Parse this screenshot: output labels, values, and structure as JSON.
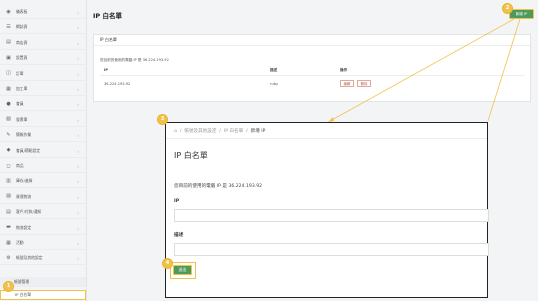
{
  "sidebar": {
    "items": [
      {
        "label": "儀表板",
        "icon": "dashboard-icon",
        "glyph": "◉"
      },
      {
        "label": "網誌頁",
        "icon": "blog-icon",
        "glyph": "☰"
      },
      {
        "label": "商店頁",
        "icon": "shop-icon",
        "glyph": "▤"
      },
      {
        "label": "設置頁",
        "icon": "settings-icon",
        "glyph": "▣"
      },
      {
        "label": "訂單",
        "icon": "order-icon",
        "glyph": "◫"
      },
      {
        "label": "加工單",
        "icon": "work-order-icon",
        "glyph": "▦"
      },
      {
        "label": "會員",
        "icon": "member-icon",
        "glyph": "●"
      },
      {
        "label": "發票單",
        "icon": "invoice-icon",
        "glyph": "▧"
      },
      {
        "label": "簡報作業",
        "icon": "report-icon",
        "glyph": "✎"
      },
      {
        "label": "會員/積點設定",
        "icon": "points-icon",
        "glyph": "◆"
      },
      {
        "label": "商品",
        "icon": "product-icon",
        "glyph": "◻"
      },
      {
        "label": "庫存/進貨",
        "icon": "inventory-icon",
        "glyph": "▥"
      },
      {
        "label": "貨運物流",
        "icon": "shipping-icon",
        "glyph": "▨"
      },
      {
        "label": "客戶/付款/通知",
        "icon": "customer-icon",
        "glyph": "▤"
      },
      {
        "label": "物流設定",
        "icon": "logistics-icon",
        "glyph": "▬"
      },
      {
        "label": "活動",
        "icon": "event-icon",
        "glyph": "▦"
      },
      {
        "label": "帳號及其他設定",
        "icon": "account-icon",
        "glyph": "⚙"
      }
    ],
    "sub_items": [
      {
        "label": "帳號管理"
      },
      {
        "label": "IP 白名單"
      }
    ]
  },
  "header": {
    "title": "IP 白名單",
    "add_button": "新增 IP"
  },
  "panel": {
    "title": "IP 白名單",
    "current_ip_text": "您目前的使用的電腦 IP 是 36.224.193.92",
    "columns": [
      "IP",
      "描述",
      "操作"
    ],
    "rows": [
      {
        "ip": "36.224.193.92",
        "desc": "ruby",
        "edit": "編輯",
        "delete": "刪除"
      }
    ]
  },
  "zoom": {
    "home_glyph": "⌂",
    "crumbs": [
      "帳號及其他設定",
      "IP 白名單",
      "新增 IP"
    ],
    "title": "IP 白名單",
    "current_ip_text": "您目前的使用的電腦 IP 是 36.224.193.92",
    "ip_label": "IP",
    "ip_value": "",
    "desc_label": "描述",
    "desc_value": "",
    "submit": "送出"
  },
  "steps": [
    "1",
    "2",
    "3",
    "4"
  ],
  "colors": {
    "accent": "#f0c24a",
    "primary": "#4e9a5b",
    "danger": "#c0584a"
  }
}
